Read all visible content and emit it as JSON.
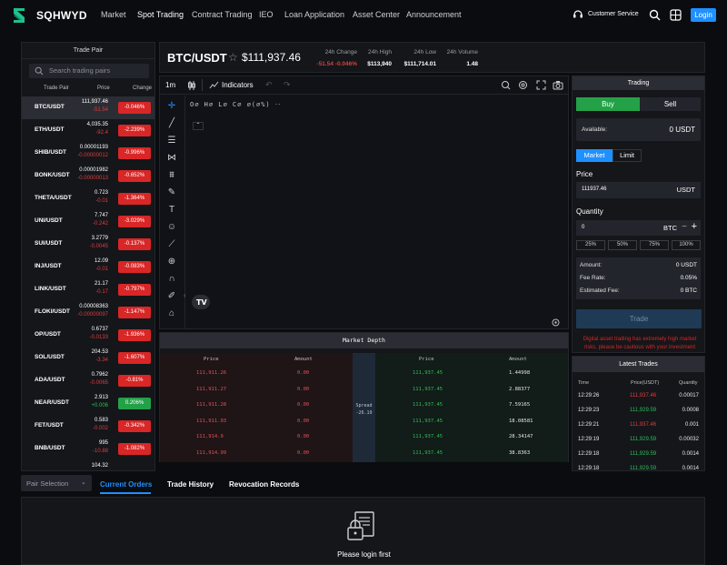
{
  "header": {
    "brand": "SQHWYD",
    "nav": [
      "Market",
      "Spot Trading",
      "Contract Trading",
      "IEO",
      "Loan Application",
      "Asset Center",
      "Announcement"
    ],
    "customer_service": "Customer Service",
    "login": "Login"
  },
  "pairs": {
    "title": "Trade Pair",
    "search_placeholder": "Search trading pairs",
    "col_pair": "Trade Pair",
    "col_price": "Price",
    "col_change": "Change",
    "rows": [
      {
        "name": "BTC/USDT",
        "price": "111,937.46",
        "change": "-51.54",
        "pct": "-0.046%",
        "dir": "neg"
      },
      {
        "name": "ETH/USDT",
        "price": "4,035.35",
        "change": "-92.4",
        "pct": "-2.239%",
        "dir": "neg"
      },
      {
        "name": "SHIB/USDT",
        "price": "0.00001193",
        "change": "-0.00000012",
        "pct": "-0.996%",
        "dir": "neg"
      },
      {
        "name": "BONK/USDT",
        "price": "0.00001982",
        "change": "-0.00000013",
        "pct": "-0.652%",
        "dir": "neg"
      },
      {
        "name": "THETA/USDT",
        "price": "0.723",
        "change": "-0.01",
        "pct": "-1.364%",
        "dir": "neg"
      },
      {
        "name": "UNI/USDT",
        "price": "7.747",
        "change": "-0.242",
        "pct": "-3.029%",
        "dir": "neg"
      },
      {
        "name": "SUI/USDT",
        "price": "3.2779",
        "change": "-0.0045",
        "pct": "-0.137%",
        "dir": "neg"
      },
      {
        "name": "INJ/USDT",
        "price": "12.09",
        "change": "-0.01",
        "pct": "-0.083%",
        "dir": "neg"
      },
      {
        "name": "LINK/USDT",
        "price": "21.17",
        "change": "-0.17",
        "pct": "-0.797%",
        "dir": "neg"
      },
      {
        "name": "FLOKI/USDT",
        "price": "0.00008363",
        "change": "-0.00000097",
        "pct": "-1.147%",
        "dir": "neg"
      },
      {
        "name": "OP/USDT",
        "price": "0.6737",
        "change": "-0.0133",
        "pct": "-1.936%",
        "dir": "neg"
      },
      {
        "name": "SOL/USDT",
        "price": "204.53",
        "change": "-3.34",
        "pct": "-1.607%",
        "dir": "neg"
      },
      {
        "name": "ADA/USDT",
        "price": "0.7962",
        "change": "-0.0065",
        "pct": "-0.81%",
        "dir": "neg"
      },
      {
        "name": "NEAR/USDT",
        "price": "2.913",
        "change": "+0.006",
        "pct": "0.206%",
        "dir": "pos"
      },
      {
        "name": "FET/USDT",
        "price": "0.583",
        "change": "-0.002",
        "pct": "-0.342%",
        "dir": "neg"
      },
      {
        "name": "BNB/USDT",
        "price": "995",
        "change": "-10.88",
        "pct": "-1.082%",
        "dir": "neg"
      },
      {
        "name": "",
        "price": "104.32",
        "change": "",
        "pct": "",
        "dir": "neg"
      }
    ]
  },
  "ticker": {
    "symbol": "BTC/USDT",
    "last": "$111,937.46",
    "change_label": "24h Change",
    "change_value": "-51.54",
    "change_pct": "-0.046%",
    "high_label": "24h High",
    "high_value": "$113,940",
    "low_label": "24h Low",
    "low_value": "$111,714.01",
    "vol_label": "24h Volume",
    "vol_value": "1.48"
  },
  "chart": {
    "interval": "1m",
    "indicators": "Indicators",
    "legend": "O∅ H∅ L∅ C∅ ∅(∅%) ‧‧",
    "tools": [
      "crosshair-icon",
      "trend-line-icon",
      "fib-icon",
      "pattern-icon",
      "measure-icon",
      "brush-icon",
      "text-icon",
      "emoji-icon",
      "ruler-icon",
      "zoom-icon",
      "magnet-icon",
      "lock-draw-icon",
      "trash-icon"
    ]
  },
  "depth": {
    "title": "Market Depth",
    "h_price": "Price",
    "h_amount": "Amount",
    "spread_label": "Spread",
    "spread_value": "-26.19",
    "bids": [
      {
        "price": "111,911.26",
        "amount": "0.00"
      },
      {
        "price": "111,911.27",
        "amount": "0.00"
      },
      {
        "price": "111,911.28",
        "amount": "0.00"
      },
      {
        "price": "111,911.93",
        "amount": "0.00"
      },
      {
        "price": "111,914.9",
        "amount": "0.00"
      },
      {
        "price": "111,914.99",
        "amount": "0.00"
      }
    ],
    "asks": [
      {
        "price": "111,937.45",
        "amount": "1.44998"
      },
      {
        "price": "111,937.45",
        "amount": "2.88377"
      },
      {
        "price": "111,937.45",
        "amount": "7.59165"
      },
      {
        "price": "111,937.45",
        "amount": "18.08581"
      },
      {
        "price": "111,937.45",
        "amount": "28.34147"
      },
      {
        "price": "111,937.45",
        "amount": "38.8363"
      }
    ]
  },
  "trading": {
    "title": "Trading",
    "buy": "Buy",
    "sell": "Sell",
    "available_label": "Available:",
    "available_value": "0 USDT",
    "market": "Market",
    "limit": "Limit",
    "price_label": "Price",
    "price_value": "111937.46",
    "price_unit": "USDT",
    "qty_label": "Quantity",
    "qty_value": "0",
    "qty_unit": "BTC",
    "pcts": [
      "25%",
      "50%",
      "75%",
      "100%"
    ],
    "amount_label": "Amount:",
    "amount_value": "0 USDT",
    "fee_label": "Fee Rate:",
    "fee_value": "0.05%",
    "est_fee_label": "Estimated Fee:",
    "est_fee_value": "0 BTC",
    "trade_button": "Trade",
    "warning": "Digital asset trading has extremely high market risks, please be cautious with your investment"
  },
  "latest_trades": {
    "title": "Latest Trades",
    "h_time": "Time",
    "h_price": "Price(USDT)",
    "h_qty": "Quantity",
    "rows": [
      {
        "time": "12:29:26",
        "price": "111,937.46",
        "qty": "0.00017",
        "dir": "neg"
      },
      {
        "time": "12:29:23",
        "price": "111,929.59",
        "qty": "0.0008",
        "dir": "pos"
      },
      {
        "time": "12:29:21",
        "price": "111,937.46",
        "qty": "0.001",
        "dir": "neg"
      },
      {
        "time": "12:29:19",
        "price": "111,929.59",
        "qty": "0.00032",
        "dir": "pos"
      },
      {
        "time": "12:29:18",
        "price": "111,929.59",
        "qty": "0.0014",
        "dir": "pos"
      },
      {
        "time": "12:29:18",
        "price": "111,929.59",
        "qty": "0.0014",
        "dir": "pos"
      }
    ]
  },
  "bottom": {
    "pair_selection": "Pair Selection",
    "tabs": [
      "Current Orders",
      "Trade History",
      "Revocation Records"
    ],
    "empty_message": "Please login first"
  },
  "colors": {
    "accent": "#1e90ff",
    "up": "#24a148",
    "down": "#d92626"
  }
}
